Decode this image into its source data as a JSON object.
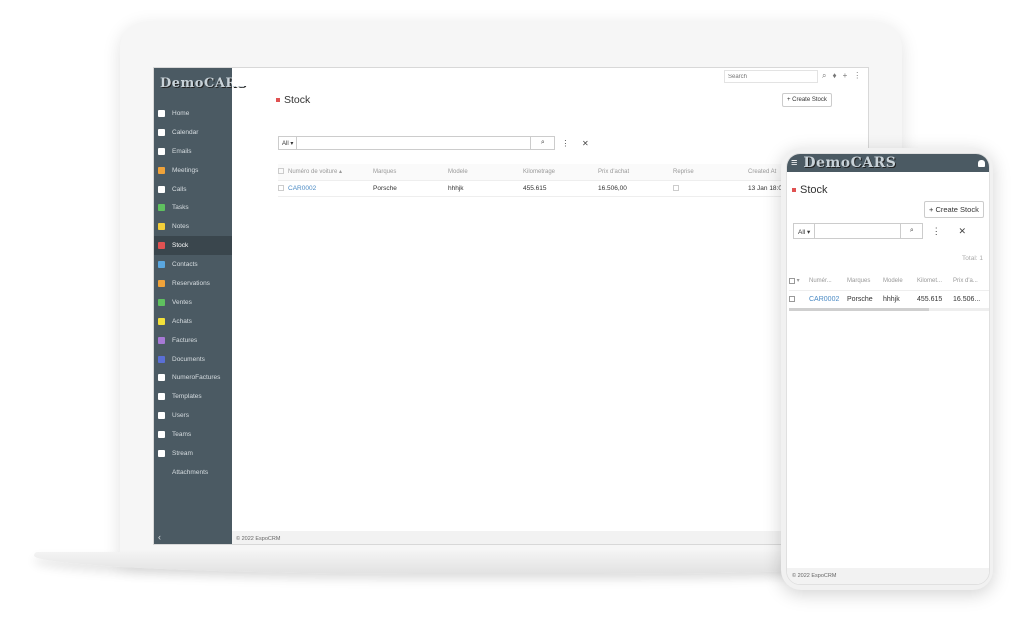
{
  "app": {
    "logo": "DemoCARS"
  },
  "sidebar": {
    "items": [
      {
        "label": "Home",
        "icon": "th-large-icon",
        "color": "#ffffff"
      },
      {
        "label": "Calendar",
        "icon": "calendar-icon",
        "color": "#ffffff"
      },
      {
        "label": "Emails",
        "icon": "envelope-icon",
        "color": "#ffffff"
      },
      {
        "label": "Meetings",
        "icon": "meetings-icon",
        "color": "#f0a33a"
      },
      {
        "label": "Calls",
        "icon": "phone-icon",
        "color": "#ffffff"
      },
      {
        "label": "Tasks",
        "icon": "tasks-icon",
        "color": "#5fc15f"
      },
      {
        "label": "Notes",
        "icon": "notes-icon",
        "color": "#f3cf3a"
      },
      {
        "label": "Stock",
        "icon": "car-icon",
        "color": "#e05252",
        "active": true
      },
      {
        "label": "Contacts",
        "icon": "contacts-icon",
        "color": "#5aa7e0"
      },
      {
        "label": "Reservations",
        "icon": "reservations-icon",
        "color": "#f0a33a"
      },
      {
        "label": "Ventes",
        "icon": "ventes-icon",
        "color": "#5fc15f"
      },
      {
        "label": "Achats",
        "icon": "cart-icon",
        "color": "#f3e13a"
      },
      {
        "label": "Factures",
        "icon": "factures-icon",
        "color": "#a779d6"
      },
      {
        "label": "Documents",
        "icon": "documents-icon",
        "color": "#5a6fd6"
      },
      {
        "label": "NumeroFactures",
        "icon": "numero-factures-icon",
        "color": "#ffffff"
      },
      {
        "label": "Templates",
        "icon": "file-icon",
        "color": "#ffffff"
      },
      {
        "label": "Users",
        "icon": "user-icon",
        "color": "#ffffff"
      },
      {
        "label": "Teams",
        "icon": "users-icon",
        "color": "#ffffff"
      },
      {
        "label": "Stream",
        "icon": "rss-icon",
        "color": "#ffffff"
      },
      {
        "label": "Attachments",
        "icon": "",
        "color": ""
      }
    ],
    "collapse_glyph": "‹"
  },
  "topbar": {
    "search_placeholder": "Search"
  },
  "page": {
    "title": "Stock",
    "create_label": "+ Create Stock",
    "filter_scope": "All ▾",
    "total": "Total: 1",
    "columns": [
      "Numéro de voiture ▴",
      "Marques",
      "Modele",
      "Kilometrage",
      "Prix d'achat",
      "Reprise",
      "Created At"
    ],
    "rows": [
      {
        "numero": "CAR0002",
        "marques": "Porsche",
        "modele": "hhhjk",
        "kilometrage": "455.615",
        "prix": "16.506,00",
        "reprise": "",
        "created": "13 Jan 18:06"
      }
    ]
  },
  "footer": {
    "text": "© 2022 EspoCRM"
  },
  "mobile": {
    "columns": [
      "Numér...",
      "Marques",
      "Modele",
      "Kilomet...",
      "Prix d'a..."
    ],
    "row": {
      "numero": "CAR0002",
      "marques": "Porsche",
      "modele": "hhhjk",
      "kilometrage": "455.615",
      "prix": "16.506..."
    }
  },
  "colors": {
    "sidebar": "#4b5a63",
    "sidebar_active": "#3a464d",
    "link": "#4a8ac4",
    "accent_red": "#e05252"
  }
}
